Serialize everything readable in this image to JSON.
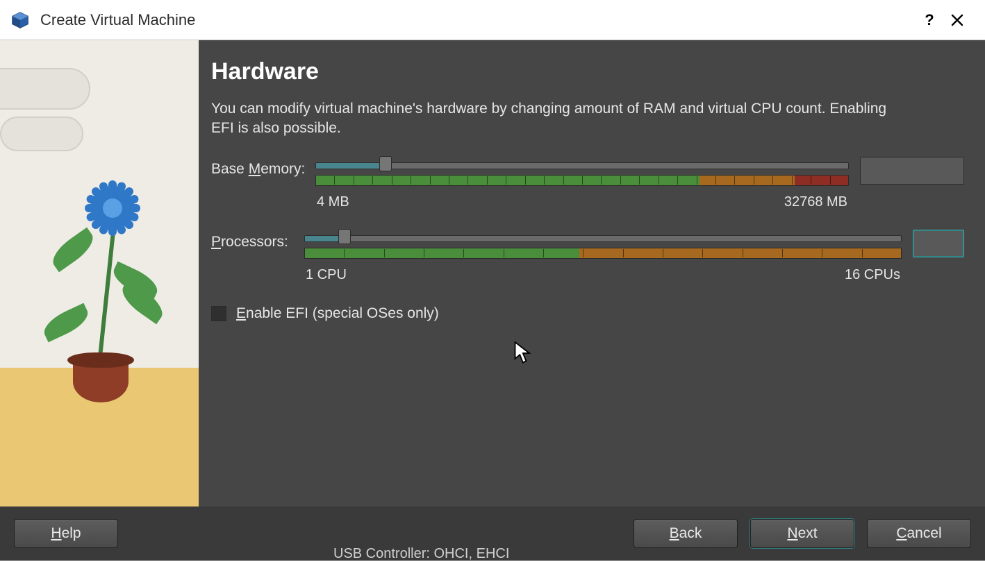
{
  "window": {
    "title": "Create Virtual Machine"
  },
  "page": {
    "heading": "Hardware",
    "description": "You can modify virtual machine's hardware by changing amount of RAM and virtual CPU count. Enabling EFI is also possible."
  },
  "memory": {
    "label_pre": "Base ",
    "label_ul": "M",
    "label_post": "emory:",
    "value": "4096",
    "unit": "MB",
    "min_label": "4 MB",
    "max_label": "32768 MB",
    "min": 4,
    "max": 32768,
    "slider_percent": 13.2,
    "ruler_green_pct": 72,
    "ruler_orange_pct": 18,
    "ruler_red_pct": 10
  },
  "cpu": {
    "label_pre": "",
    "label_ul": "P",
    "label_post": "rocessors:",
    "value": "2",
    "min_label": "1 CPU",
    "max_label": "16 CPUs",
    "min": 1,
    "max": 16,
    "slider_percent": 6.7,
    "ruler_green_pct": 46,
    "ruler_orange_pct": 54,
    "ruler_red_pct": 0
  },
  "efi": {
    "label_ul": "E",
    "label_post": "nable EFI (special OSes only)",
    "checked": false
  },
  "buttons": {
    "help_ul": "H",
    "help_post": "elp",
    "back_ul": "B",
    "back_post": "ack",
    "next_ul": "N",
    "next_post": "ext",
    "cancel_ul": "C",
    "cancel_post": "ancel"
  },
  "peek_text": "USB Controller:   OHCI, EHCI"
}
